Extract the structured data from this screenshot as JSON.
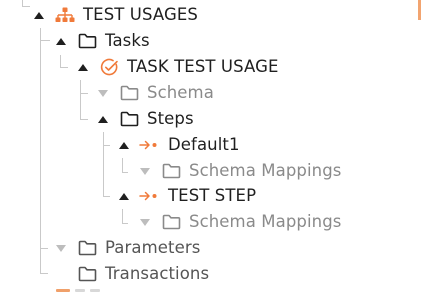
{
  "tree": {
    "nodes": [
      {
        "label": "TEST USAGES",
        "icon": "hierarchy-icon",
        "expanded": true
      },
      {
        "label": "Tasks",
        "icon": "folder-icon",
        "expanded": true
      },
      {
        "label": "TASK TEST USAGE",
        "icon": "task-check-icon",
        "expanded": true
      },
      {
        "label": "Schema",
        "icon": "folder-icon",
        "expanded": false
      },
      {
        "label": "Steps",
        "icon": "folder-icon",
        "expanded": true
      },
      {
        "label": "Default1",
        "icon": "step-arrow-icon",
        "expanded": true
      },
      {
        "label": "Schema Mappings",
        "icon": "folder-icon",
        "expanded": false
      },
      {
        "label": "TEST STEP",
        "icon": "step-arrow-icon",
        "expanded": true
      },
      {
        "label": "Schema Mappings",
        "icon": "folder-icon",
        "expanded": false
      },
      {
        "label": "Parameters",
        "icon": "folder-icon",
        "expanded": false
      },
      {
        "label": "Transactions",
        "icon": "folder-icon",
        "expanded": false
      }
    ]
  },
  "colors": {
    "accent": "#f07a3a",
    "text": "#1f1f1f",
    "muted_text": "#8a8a8a",
    "tree_line": "#c9c9c9"
  }
}
